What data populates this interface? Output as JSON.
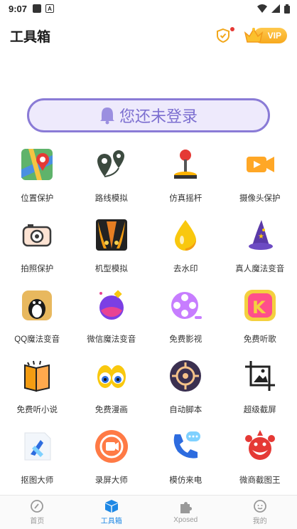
{
  "status_bar": {
    "time": "9:07"
  },
  "header": {
    "title": "工具箱",
    "vip_label": "VIP"
  },
  "login_banner": {
    "label": "您还未登录"
  },
  "tools": [
    {
      "label": "位置保护",
      "icon": "map-pin-icon"
    },
    {
      "label": "路线模拟",
      "icon": "route-icon"
    },
    {
      "label": "仿真摇杆",
      "icon": "joystick-icon"
    },
    {
      "label": "摄像头保护",
      "icon": "camera-video-icon"
    },
    {
      "label": "拍照保护",
      "icon": "camera-icon"
    },
    {
      "label": "机型模拟",
      "icon": "phone-model-icon"
    },
    {
      "label": "去水印",
      "icon": "water-drop-icon"
    },
    {
      "label": "真人魔法变音",
      "icon": "wizard-hat-icon"
    },
    {
      "label": "QQ魔法变音",
      "icon": "penguin-icon"
    },
    {
      "label": "微信魔法变音",
      "icon": "magic-potion-icon"
    },
    {
      "label": "免费影视",
      "icon": "film-reel-icon"
    },
    {
      "label": "免费听歌",
      "icon": "music-k-icon"
    },
    {
      "label": "免费听小说",
      "icon": "book-icon"
    },
    {
      "label": "免费漫画",
      "icon": "cartoon-eyes-icon"
    },
    {
      "label": "自动脚本",
      "icon": "target-icon"
    },
    {
      "label": "超级截屏",
      "icon": "crop-image-icon"
    },
    {
      "label": "抠图大师",
      "icon": "cutout-icon"
    },
    {
      "label": "录屏大师",
      "icon": "screen-record-icon"
    },
    {
      "label": "模仿来电",
      "icon": "phone-call-icon"
    },
    {
      "label": "微商截图王",
      "icon": "clown-icon"
    }
  ],
  "bottom_nav": [
    {
      "label": "首页",
      "icon": "home-icon",
      "active": false
    },
    {
      "label": "工具箱",
      "icon": "toolbox-icon",
      "active": true
    },
    {
      "label": "Xposed",
      "icon": "puzzle-icon",
      "active": false
    },
    {
      "label": "我的",
      "icon": "profile-icon",
      "active": false
    }
  ],
  "colors": {
    "accent": "#1e88e5",
    "login_border": "#8a7bd6",
    "vip": "#f7a91e"
  }
}
